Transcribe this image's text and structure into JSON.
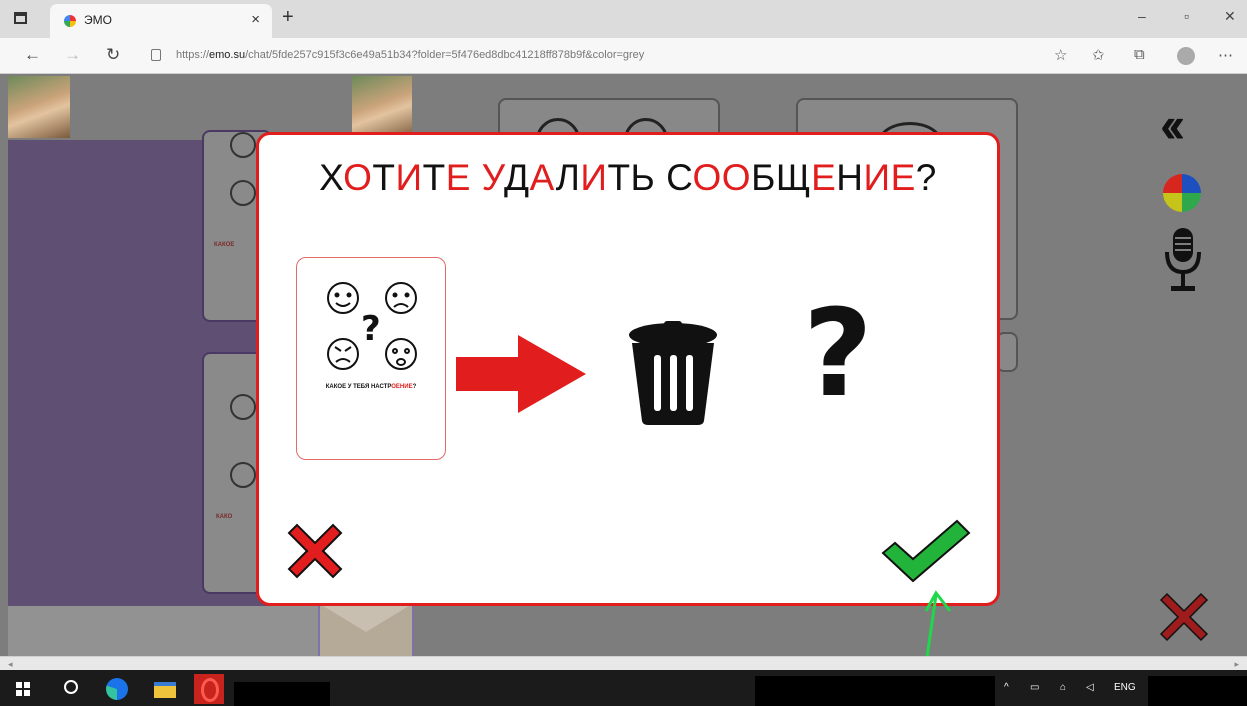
{
  "browser": {
    "tab_title": "ЭМО",
    "tab_close": "×",
    "new_tab": "+",
    "url_domain": "emo.su",
    "url_prefix": "https://",
    "url_path": "/chat/5fde257c915f3c6e49a51b34?folder=5f476ed8dbc41218ff878b9f&color=grey",
    "window_controls": {
      "minimize": "–",
      "restore": "▫",
      "close": "✕"
    },
    "nav": {
      "back": "←",
      "forward": "→",
      "refresh": "↻"
    }
  },
  "app": {
    "card_caption_partial": "КАКОЕ",
    "card_caption_partial_2": "КАКО"
  },
  "modal": {
    "title_segments": [
      {
        "text": "Х",
        "red": false
      },
      {
        "text": "О",
        "red": true
      },
      {
        "text": "Т",
        "red": false
      },
      {
        "text": "И",
        "red": true
      },
      {
        "text": "Т",
        "red": false
      },
      {
        "text": "Е",
        "red": true
      },
      {
        "text": " ",
        "red": false
      },
      {
        "text": "У",
        "red": true
      },
      {
        "text": "Д",
        "red": false
      },
      {
        "text": "А",
        "red": true
      },
      {
        "text": "Л",
        "red": false
      },
      {
        "text": "И",
        "red": true
      },
      {
        "text": "ТЬ С",
        "red": false
      },
      {
        "text": "ОО",
        "red": true
      },
      {
        "text": "БЩ",
        "red": false
      },
      {
        "text": "Е",
        "red": true
      },
      {
        "text": "Н",
        "red": false
      },
      {
        "text": "ИЕ",
        "red": true
      },
      {
        "text": "?",
        "red": false
      }
    ],
    "card_caption_a": "КАКОЕ У ТЕБЯ НАСТР",
    "card_caption_b": "ОЕНИЕ",
    "card_caption_c": "?",
    "question_mark": "?"
  },
  "taskbar": {
    "tray_lang": "ENG",
    "tray_chevron": "^"
  },
  "colors": {
    "accent_red": "#e11d1d",
    "confirm_green": "#22b43a",
    "app_background": "#7d7d7d",
    "panel_purple": "#5e4f73"
  },
  "icons": {
    "cancel": "red-x-icon",
    "confirm": "green-check-icon",
    "delete": "trash-can-icon",
    "transform": "red-arrow-icon",
    "collapse": "double-chevron-left-icon",
    "palette": "color-wheel-icon",
    "voice": "microphone-icon",
    "close_chat": "red-x-icon"
  }
}
